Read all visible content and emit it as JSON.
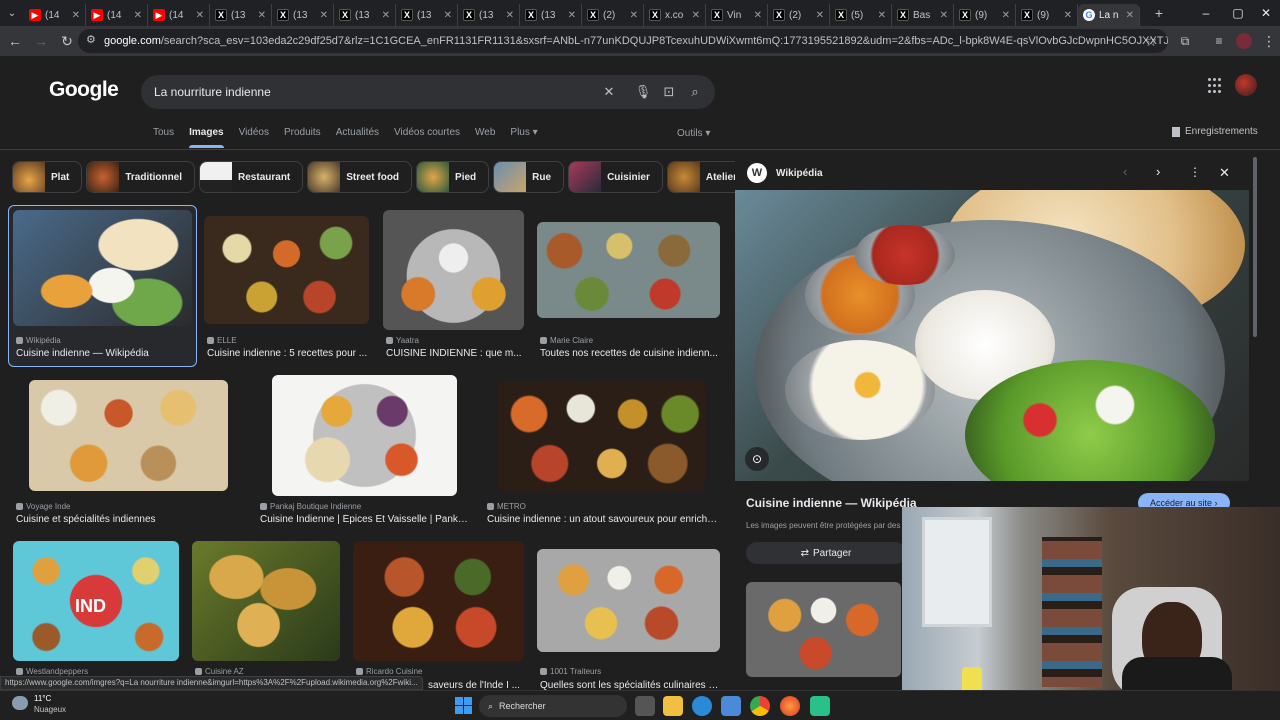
{
  "browser": {
    "tabs": [
      {
        "icon": "youtube-icon",
        "label": "(14"
      },
      {
        "icon": "youtube-icon",
        "label": "(14"
      },
      {
        "icon": "youtube-icon",
        "label": "(14"
      },
      {
        "icon": "x-icon",
        "label": "(13"
      },
      {
        "icon": "x-icon",
        "label": "(13"
      },
      {
        "icon": "x-icon",
        "label": "(13"
      },
      {
        "icon": "x-icon",
        "label": "(13"
      },
      {
        "icon": "x-icon",
        "label": "(13"
      },
      {
        "icon": "x-icon",
        "label": "(13"
      },
      {
        "icon": "x-icon",
        "label": "(2)"
      },
      {
        "icon": "x-icon",
        "label": "x.co"
      },
      {
        "icon": "x-icon",
        "label": "Vin"
      },
      {
        "icon": "x-icon",
        "label": "(2)"
      },
      {
        "icon": "x-icon",
        "label": "(5)"
      },
      {
        "icon": "x-icon",
        "label": "Bas"
      },
      {
        "icon": "x-icon",
        "label": "(9)"
      },
      {
        "icon": "x-icon",
        "label": "(9)"
      },
      {
        "icon": "google-icon",
        "label": "La n"
      }
    ],
    "url_host": "google.com",
    "url_path": "/search?sca_esv=103eda2c29df25d7&rlz=1C1GCEA_enFR1131FR1131&sxsrf=ANbL-n77unKDQUJP8TcexuhUDWiXwmt6mQ:1773195521892&udm=2&fbs=ADc_l-bpk8W4E-qsVlOvbGJcDwpnHC5OJXXTJvmMu2n9YYx-G8xzgQk24aW1N_Fyl..."
  },
  "google": {
    "logo": "Google",
    "query": "La nourriture indienne",
    "tabs": [
      "Tous",
      "Images",
      "Vidéos",
      "Produits",
      "Actualités",
      "Vidéos courtes",
      "Web",
      "Plus ▾"
    ],
    "tools": "Outils ▾",
    "saved": "Enregistrements",
    "chips": [
      "Plat",
      "Traditionnel",
      "Restaurant",
      "Street food",
      "Pied",
      "Rue",
      "Cuisinier",
      "Atelier cuisi"
    ]
  },
  "results": [
    {
      "source": "Wikipédia",
      "title": "Cuisine indienne — Wikipédia"
    },
    {
      "source": "ELLE",
      "title": "Cuisine indienne : 5 recettes pour ..."
    },
    {
      "source": "Yaatra",
      "title": "CUISINE INDIENNE : que m..."
    },
    {
      "source": "Marie Claire",
      "title": "Toutes nos recettes de cuisine indienn..."
    },
    {
      "source": "Voyage Inde",
      "title": "Cuisine et spécialités indiennes"
    },
    {
      "source": "Pankaj Boutique Indienne",
      "title": "Cuisine Indienne | Épices Et Vaisselle | Pankaj..."
    },
    {
      "source": "METRO",
      "title": "Cuisine indienne : un atout savoureux pour enrichir ..."
    },
    {
      "source": "Westlandpeppers",
      "title": ""
    },
    {
      "source": "Cuisine AZ",
      "title": ""
    },
    {
      "source": "Ricardo Cuisine",
      "title": "saveurs de l'Inde I ..."
    },
    {
      "source": "1001 Traiteurs",
      "title": "Quelles sont les spécialités culinaires d..."
    }
  ],
  "panel": {
    "source": "Wikipédia",
    "title": "Cuisine indienne — Wikipédia",
    "visit": "Accéder au site ›",
    "notice": "Les images peuvent être protégées par des",
    "share": "Partager"
  },
  "statusbar": "https://www.google.com/imgres?q=La nourriture indienne&imgurl=https%3A%2F%2Fupload.wikimedia.org%2Fwiki...",
  "taskbar": {
    "temp": "11°C",
    "weather": "Nuageux",
    "search": "Rechercher"
  }
}
